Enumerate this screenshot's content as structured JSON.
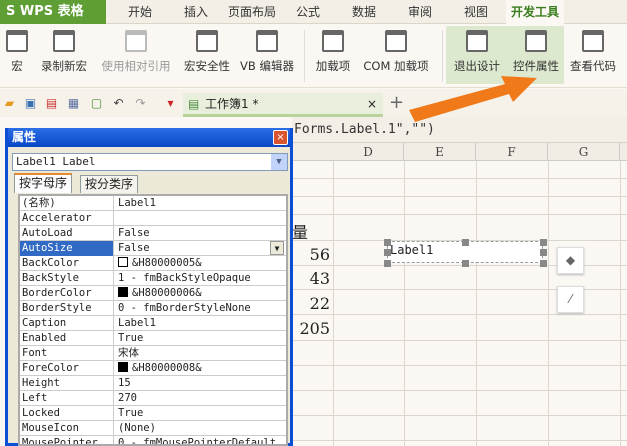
{
  "app": {
    "logo": "S WPS 表格"
  },
  "menu_tabs": [
    "开始",
    "插入",
    "页面布局",
    "公式",
    "数据",
    "审阅",
    "视图",
    "开发工具"
  ],
  "active_tab": "开发工具",
  "ribbon": [
    "宏",
    "录制新宏",
    "使用相对引用",
    "宏安全性",
    "VB 编辑器",
    "加载项",
    "COM 加载项",
    "退出设计",
    "控件属性",
    "查看代码"
  ],
  "doc_tab": {
    "title": "工作簿1 *",
    "close": "×",
    "new": "+"
  },
  "formula": "Forms.Label.1\",\"\")",
  "columns": [
    "D",
    "E",
    "F",
    "G"
  ],
  "cells": {
    "header_partial": "量",
    "values": [
      "56",
      "43",
      "22",
      "205"
    ]
  },
  "label_control": "Label1",
  "dialog": {
    "title": "属性",
    "close": "×",
    "object": "Label1 Label",
    "tabs": [
      "按字母序",
      "按分类序"
    ],
    "rows": [
      {
        "name": "(名称)",
        "value": "Label1"
      },
      {
        "name": "Accelerator",
        "value": ""
      },
      {
        "name": "AutoLoad",
        "value": "False"
      },
      {
        "name": "AutoSize",
        "value": "False"
      },
      {
        "name": "BackColor",
        "value": "&H80000005&",
        "swatch": "#ffffff"
      },
      {
        "name": "BackStyle",
        "value": "1 - fmBackStyleOpaque"
      },
      {
        "name": "BorderColor",
        "value": "&H80000006&",
        "swatch": "#000000"
      },
      {
        "name": "BorderStyle",
        "value": "0 - fmBorderStyleNone"
      },
      {
        "name": "Caption",
        "value": "Label1"
      },
      {
        "name": "Enabled",
        "value": "True"
      },
      {
        "name": "Font",
        "value": "宋体"
      },
      {
        "name": "ForeColor",
        "value": "&H80000008&",
        "swatch": "#000000"
      },
      {
        "name": "Height",
        "value": "15"
      },
      {
        "name": "Left",
        "value": "270"
      },
      {
        "name": "Locked",
        "value": "True"
      },
      {
        "name": "MouseIcon",
        "value": "(None)"
      },
      {
        "name": "MousePointer",
        "value": "0 - fmMousePointerDefault"
      }
    ],
    "selected_row": "AutoSize"
  },
  "colors": {
    "brand": "#5f9e35",
    "dialog_title": "#0a4fd6",
    "selection": "#316ac5",
    "arrow": "#f07a1a"
  }
}
